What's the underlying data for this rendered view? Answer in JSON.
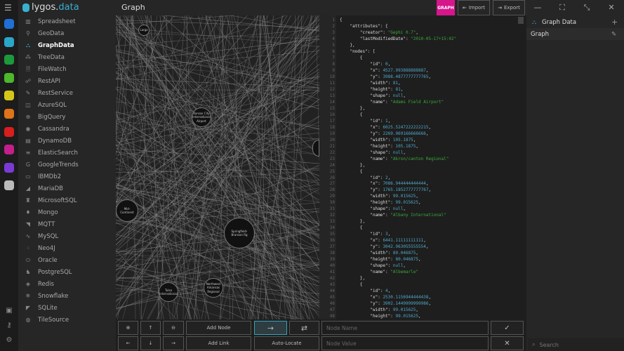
{
  "app": {
    "logo_text": "lygos.",
    "logo_accent": "data",
    "title": "Graph"
  },
  "rail": {
    "apps": [
      {
        "icon": "spreadsheet-app-icon",
        "color": "#1f6fd6"
      },
      {
        "icon": "database-app-icon",
        "color": "#2aa6c9"
      },
      {
        "icon": "js-app-icon",
        "color": "#1c9a3c"
      },
      {
        "icon": "tree-app-icon",
        "color": "#4cb82c"
      },
      {
        "icon": "chart-app-icon",
        "color": "#d4c619"
      },
      {
        "icon": "cube-app-icon",
        "color": "#e0731a"
      },
      {
        "icon": "funnel-app-icon",
        "color": "#d81e1e"
      },
      {
        "icon": "grid-app-icon",
        "color": "#c41e8c"
      },
      {
        "icon": "network-app-icon",
        "color": "#7b3ad6"
      },
      {
        "icon": "plugin-app-icon",
        "color": "#bbbbbb"
      }
    ],
    "bottom_icons": [
      "terminal-icon",
      "key-icon",
      "gear-icon"
    ]
  },
  "sidebar": {
    "items": [
      {
        "label": "Spreadsheet",
        "icon": "▥"
      },
      {
        "label": "GeoData",
        "icon": "⚲"
      },
      {
        "label": "GraphData",
        "icon": "⛬",
        "active": true
      },
      {
        "label": "TreeData",
        "icon": "⁂"
      },
      {
        "label": "FileWatch",
        "icon": "🗎"
      },
      {
        "label": "RestAPI",
        "icon": "☍"
      },
      {
        "label": "RestService",
        "icon": "✎"
      },
      {
        "label": "AzureSQL",
        "icon": "◫"
      },
      {
        "label": "BigQuery",
        "icon": "⊕"
      },
      {
        "label": "Cassandra",
        "icon": "◉"
      },
      {
        "label": "DynamoDB",
        "icon": "▤"
      },
      {
        "label": "ElasticSearch",
        "icon": "≡"
      },
      {
        "label": "GoogleTrends",
        "icon": "G"
      },
      {
        "label": "IBMDb2",
        "icon": "▭"
      },
      {
        "label": "MariaDB",
        "icon": "◢"
      },
      {
        "label": "MicrosoftSQL",
        "icon": "♜"
      },
      {
        "label": "Mongo",
        "icon": "♦"
      },
      {
        "label": "MQTT",
        "icon": "◥"
      },
      {
        "label": "MySQL",
        "icon": "∿"
      },
      {
        "label": "Neo4J",
        "icon": "⁖"
      },
      {
        "label": "Oracle",
        "icon": "⬭"
      },
      {
        "label": "PostgreSQL",
        "icon": "♞"
      },
      {
        "label": "Redis",
        "icon": "◈"
      },
      {
        "label": "Snowflake",
        "icon": "❄"
      },
      {
        "label": "SQLite",
        "icon": "◤"
      },
      {
        "label": "TileSource",
        "icon": "◍"
      }
    ]
  },
  "toolbar": {
    "badge": "GRAPH",
    "import": "Import",
    "export": "Export",
    "window": [
      "—",
      "⛶",
      "⤡",
      "✕"
    ]
  },
  "graph": {
    "nodes": [
      "Largo",
      "Kansas City International Airport",
      "Mid-Continent",
      "Springfield-Branson Rg",
      "Tulsa International",
      "Northwest Arkansas Regional"
    ]
  },
  "code": {
    "lines": [
      "{",
      "    \"attributes\": {",
      "        \"creator\": \"Gephi 0.7\",",
      "        \"lastModifiedDate\": \"2010-05-17+15:02\"",
      "    },",
      "    \"nodes\": [",
      "        {",
      "            \"id\": 0,",
      "            \"x\": 4527.993888888887,",
      "            \"y\": 3988.4877777777765,",
      "            \"width\": 81,",
      "            \"height\": 81,",
      "            \"shape\": null,",
      "            \"name\": \"Adams Field Airport\"",
      "        },",
      "        {",
      "            \"id\": 1,",
      "            \"x\": 6025.5247222222215,",
      "            \"y\": 2269.969166666666,",
      "            \"width\": 105.1875,",
      "            \"height\": 105.1875,",
      "            \"shape\": null,",
      "            \"name\": \"Akron/canton Regional\"",
      "        },",
      "        {",
      "            \"id\": 2,",
      "            \"x\": 7086.944444444444,",
      "            \"y\": 1765.1852777777767,",
      "            \"width\": 99.015625,",
      "            \"height\": 99.015625,",
      "            \"shape\": null,",
      "            \"name\": \"Albany International\"",
      "        },",
      "        {",
      "            \"id\": 3,",
      "            \"x\": 6441.11111111111,",
      "            \"y\": 3042.963055555554,",
      "            \"width\": 80.046875,",
      "            \"height\": 80.046875,",
      "            \"shape\": null,",
      "            \"name\": \"Albemarle\"",
      "        },",
      "        {",
      "            \"id\": 4,",
      "            \"x\": 2530.1156944444438,",
      "            \"y\": 3902.1449999999986,",
      "            \"width\": 99.015625,",
      "            \"height\": 99.015625,"
    ]
  },
  "panel": {
    "header": "Graph Data",
    "add": "+",
    "item": "Graph",
    "edit": "✎",
    "search_placeholder": "Search"
  },
  "controls": {
    "zoom_in": "⊕",
    "up": "↑",
    "zoom_out": "⊖",
    "left": "←",
    "down": "↓",
    "right": "→",
    "add_node": "Add Node",
    "add_link": "Add Link",
    "directed": "→",
    "bidirectional": "⇄",
    "auto_locate": "Auto-Locate",
    "node_name_placeholder": "Node Name",
    "node_value_placeholder": "Node Value",
    "confirm": "✓",
    "cancel": "✕"
  }
}
